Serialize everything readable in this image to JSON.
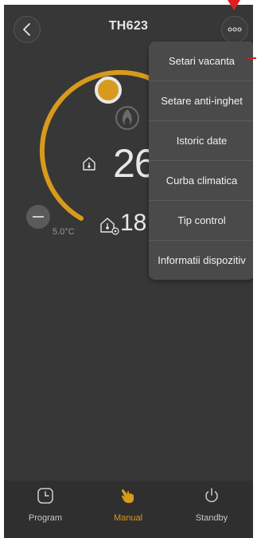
{
  "header": {
    "title": "TH623",
    "back_icon": "chevron-left-icon",
    "more_icon": "more-dots-icon"
  },
  "thermostat": {
    "setpoint_display": "26",
    "room_display": "18",
    "min_label": "5.0°C",
    "mode_icon": "flame-icon",
    "setpoint_icon": "home-thermometer-icon",
    "room_icon": "home-sensor-icon"
  },
  "menu": {
    "items": [
      {
        "label": "Setari vacanta"
      },
      {
        "label": "Setare anti-inghet"
      },
      {
        "label": "Istoric date"
      },
      {
        "label": "Curba climatica"
      },
      {
        "label": "Tip control"
      },
      {
        "label": "Informatii dispozitiv"
      }
    ]
  },
  "tabbar": {
    "tabs": [
      {
        "label": "Program",
        "icon": "clock-icon"
      },
      {
        "label": "Manual",
        "icon": "hand-pointer-icon",
        "active": true
      },
      {
        "label": "Standby",
        "icon": "power-icon"
      }
    ]
  },
  "colors": {
    "accent": "#d89a1c",
    "background": "#373737",
    "menu_bg": "#4a4a4a",
    "annotation": "#e01e1e"
  }
}
